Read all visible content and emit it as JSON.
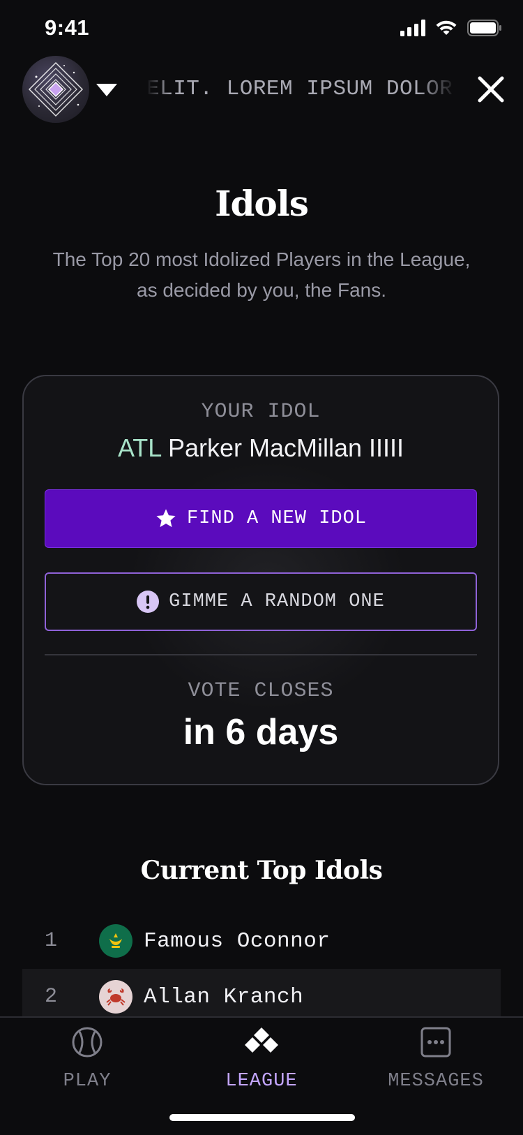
{
  "status_bar": {
    "time": "9:41"
  },
  "header": {
    "ticker_text": "ELIT. LOREM IPSUM DOLOR"
  },
  "page": {
    "title": "Idols",
    "subtitle": "The Top 20 most Idolized Players in the League, as decided by you, the Fans."
  },
  "idol_card": {
    "label": "YOUR IDOL",
    "team_abbr": "ATL",
    "player_name": "Parker MacMillan IIIII",
    "primary_button": "FIND A NEW IDOL",
    "secondary_button": "GIMME A RANDOM ONE",
    "vote_label": "VOTE CLOSES",
    "vote_value": "in 6 days"
  },
  "top_idols": {
    "title": "Current Top Idols",
    "rows": [
      {
        "rank": "1",
        "name": "Famous Oconnor",
        "team_icon": "team-crown-icon",
        "team_color": "#0f6e4a"
      },
      {
        "rank": "2",
        "name": "Allan Kranch",
        "team_icon": "team-crab-icon",
        "team_color": "#e6d3d4"
      }
    ]
  },
  "tabs": [
    {
      "label": "PLAY",
      "icon": "baseball-icon",
      "active": false
    },
    {
      "label": "LEAGUE",
      "icon": "league-diamonds-icon",
      "active": true
    },
    {
      "label": "MESSAGES",
      "icon": "messages-icon",
      "active": false
    }
  ],
  "colors": {
    "accent_purple": "#5b0bbd",
    "active_tab": "#c4a6ff",
    "team_abbr": "#a8e3c9"
  }
}
